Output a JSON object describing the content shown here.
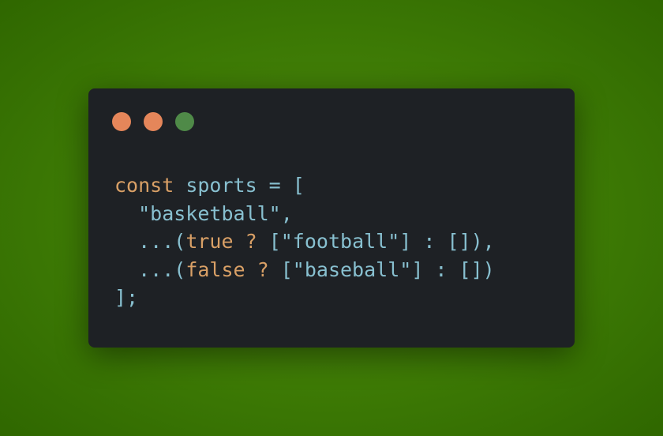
{
  "colors": {
    "background": "#3d7a05",
    "window": "#1e2125",
    "keyword": "#d9a066",
    "plain": "#88c0d0",
    "string": "#88c0d0",
    "punctuation": "#88c0d0"
  },
  "window_controls": [
    {
      "name": "close",
      "color": "#e5865a"
    },
    {
      "name": "minimize",
      "color": "#e5865a"
    },
    {
      "name": "maximize",
      "color": "#4f8a48"
    }
  ],
  "code": {
    "lines": [
      [
        {
          "text": "const",
          "kind": "keyword"
        },
        {
          "text": " sports = [",
          "kind": "plain"
        }
      ],
      [
        {
          "text": "  \"basketball\",",
          "kind": "plain"
        }
      ],
      [
        {
          "text": "  ...(",
          "kind": "plain"
        },
        {
          "text": "true",
          "kind": "keyword"
        },
        {
          "text": " ",
          "kind": "plain"
        },
        {
          "text": "?",
          "kind": "keyword"
        },
        {
          "text": " [\"football\"] : []),",
          "kind": "plain"
        }
      ],
      [
        {
          "text": "  ...(",
          "kind": "plain"
        },
        {
          "text": "false",
          "kind": "keyword"
        },
        {
          "text": " ",
          "kind": "plain"
        },
        {
          "text": "?",
          "kind": "keyword"
        },
        {
          "text": " [\"baseball\"] : [])",
          "kind": "plain"
        }
      ],
      [
        {
          "text": "];",
          "kind": "plain"
        }
      ]
    ]
  }
}
